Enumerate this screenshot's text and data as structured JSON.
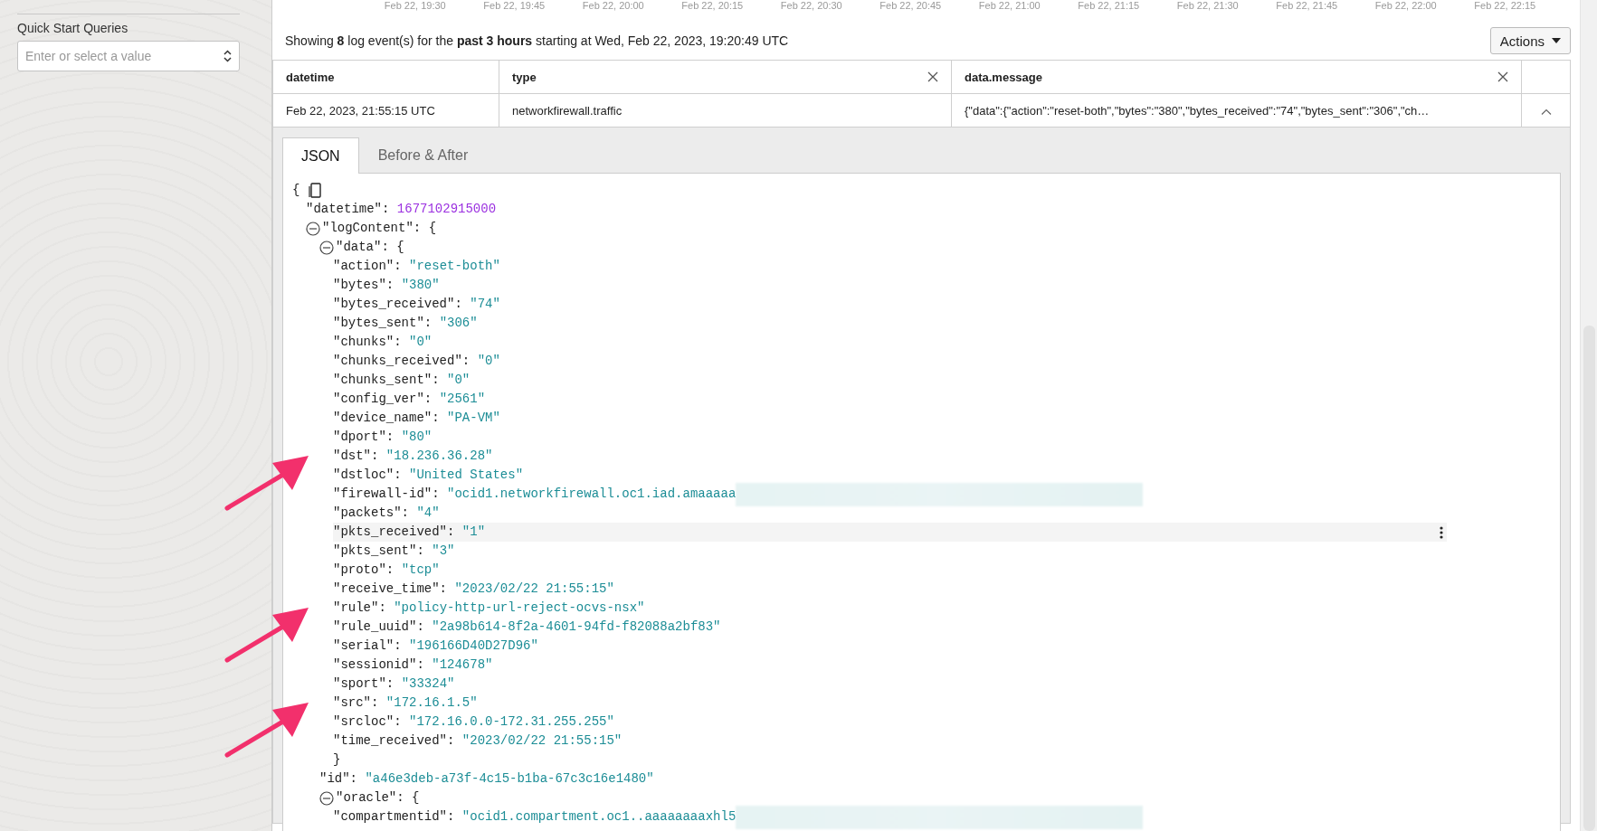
{
  "sidebar": {
    "label": "Quick Start Queries",
    "select": {
      "placeholder": "Enter or select a value"
    }
  },
  "timeline": {
    "ticks": [
      "Feb 22, 19:30",
      "Feb 22, 19:45",
      "Feb 22, 20:00",
      "Feb 22, 20:15",
      "Feb 22, 20:30",
      "Feb 22, 20:45",
      "Feb 22, 21:00",
      "Feb 22, 21:15",
      "Feb 22, 21:30",
      "Feb 22, 21:45",
      "Feb 22, 22:00",
      "Feb 22, 22:15"
    ]
  },
  "summary": "Showing **8** log event(s) for the **past 3 hours** starting at Wed, Feb 22, 2023, 19:20:49 UTC",
  "actions_button": "Actions",
  "table": {
    "columns": [
      {
        "label": "datetime",
        "closable": false
      },
      {
        "label": "type",
        "closable": true
      },
      {
        "label": "data.message",
        "closable": true
      }
    ],
    "rows": [
      {
        "cells": [
          "Feb 22, 2023, 21:55:15 UTC",
          "networkfirewall.traffic",
          "{\"data\":{\"action\":\"reset-both\",\"bytes\":\"380\",\"bytes_received\":\"74\",\"bytes_sent\":\"306\",\"ch…"
        ],
        "expanded": true
      }
    ]
  },
  "tabs": [
    {
      "label": "JSON",
      "selected": true
    },
    {
      "label": "Before & After",
      "selected": false
    }
  ],
  "json": {
    "open": "{",
    "children": [
      {
        "kind": "number",
        "key": "\"datetime\":",
        "value": "1677102915000",
        "highlighted": false,
        "arrow": false,
        "redacted": false
      },
      {
        "kind": "object",
        "key": "\"logContent\":",
        "open": "{",
        "expanded": true,
        "highlighted": false,
        "arrow": false,
        "redacted": false,
        "children": [
          {
            "kind": "object",
            "key": "\"data\":",
            "open": "{",
            "close": "}",
            "expanded": true,
            "highlighted": false,
            "arrow": false,
            "redacted": false,
            "children": [
              {
                "kind": "string",
                "key": "\"action\":",
                "value": "\"reset-both\"",
                "highlighted": false,
                "arrow": false,
                "redacted": false
              },
              {
                "kind": "string",
                "key": "\"bytes\":",
                "value": "\"380\"",
                "highlighted": false,
                "arrow": false,
                "redacted": false
              },
              {
                "kind": "string",
                "key": "\"bytes_received\":",
                "value": "\"74\"",
                "highlighted": false,
                "arrow": false,
                "redacted": false
              },
              {
                "kind": "string",
                "key": "\"bytes_sent\":",
                "value": "\"306\"",
                "highlighted": false,
                "arrow": false,
                "redacted": false
              },
              {
                "kind": "string",
                "key": "\"chunks\":",
                "value": "\"0\"",
                "highlighted": false,
                "arrow": false,
                "redacted": false
              },
              {
                "kind": "string",
                "key": "\"chunks_received\":",
                "value": "\"0\"",
                "highlighted": false,
                "arrow": false,
                "redacted": false
              },
              {
                "kind": "string",
                "key": "\"chunks_sent\":",
                "value": "\"0\"",
                "highlighted": false,
                "arrow": false,
                "redacted": false
              },
              {
                "kind": "string",
                "key": "\"config_ver\":",
                "value": "\"2561\"",
                "highlighted": false,
                "arrow": false,
                "redacted": false
              },
              {
                "kind": "string",
                "key": "\"device_name\":",
                "value": "\"PA-VM\"",
                "highlighted": false,
                "arrow": false,
                "redacted": false
              },
              {
                "kind": "string",
                "key": "\"dport\":",
                "value": "\"80\"",
                "highlighted": false,
                "arrow": false,
                "redacted": false
              },
              {
                "kind": "string",
                "key": "\"dst\":",
                "value": "\"18.236.36.28\"",
                "highlighted": false,
                "arrow": true,
                "redacted": false
              },
              {
                "kind": "string",
                "key": "\"dstloc\":",
                "value": "\"United States\"",
                "highlighted": false,
                "arrow": false,
                "redacted": false
              },
              {
                "kind": "string",
                "key": "\"firewall-id\":",
                "value": "\"ocid1.networkfirewall.oc1.iad.amaaaaa",
                "highlighted": false,
                "arrow": false,
                "redacted": true
              },
              {
                "kind": "string",
                "key": "\"packets\":",
                "value": "\"4\"",
                "highlighted": false,
                "arrow": false,
                "redacted": false
              },
              {
                "kind": "string",
                "key": "\"pkts_received\":",
                "value": "\"1\"",
                "highlighted": true,
                "arrow": false,
                "redacted": false
              },
              {
                "kind": "string",
                "key": "\"pkts_sent\":",
                "value": "\"3\"",
                "highlighted": false,
                "arrow": false,
                "redacted": false
              },
              {
                "kind": "string",
                "key": "\"proto\":",
                "value": "\"tcp\"",
                "highlighted": false,
                "arrow": false,
                "redacted": false
              },
              {
                "kind": "string",
                "key": "\"receive_time\":",
                "value": "\"2023/02/22 21:55:15\"",
                "highlighted": false,
                "arrow": false,
                "redacted": false
              },
              {
                "kind": "string",
                "key": "\"rule\":",
                "value": "\"policy-http-url-reject-ocvs-nsx\"",
                "highlighted": false,
                "arrow": true,
                "redacted": false
              },
              {
                "kind": "string",
                "key": "\"rule_uuid\":",
                "value": "\"2a98b614-8f2a-4601-94fd-f82088a2bf83\"",
                "highlighted": false,
                "arrow": false,
                "redacted": false
              },
              {
                "kind": "string",
                "key": "\"serial\":",
                "value": "\"196166D40D27D96\"",
                "highlighted": false,
                "arrow": false,
                "redacted": false
              },
              {
                "kind": "string",
                "key": "\"sessionid\":",
                "value": "\"124678\"",
                "highlighted": false,
                "arrow": false,
                "redacted": false
              },
              {
                "kind": "string",
                "key": "\"sport\":",
                "value": "\"33324\"",
                "highlighted": false,
                "arrow": false,
                "redacted": false
              },
              {
                "kind": "string",
                "key": "\"src\":",
                "value": "\"172.16.1.5\"",
                "highlighted": false,
                "arrow": true,
                "redacted": false
              },
              {
                "kind": "string",
                "key": "\"srcloc\":",
                "value": "\"172.16.0.0-172.31.255.255\"",
                "highlighted": false,
                "arrow": false,
                "redacted": false
              },
              {
                "kind": "string",
                "key": "\"time_received\":",
                "value": "\"2023/02/22 21:55:15\"",
                "highlighted": false,
                "arrow": false,
                "redacted": false
              }
            ]
          },
          {
            "kind": "string",
            "key": "\"id\":",
            "value": "\"a46e3deb-a73f-4c15-b1ba-67c3c16e1480\"",
            "highlighted": false,
            "arrow": false,
            "redacted": false
          },
          {
            "kind": "object",
            "key": "\"oracle\":",
            "open": "{",
            "expanded": true,
            "highlighted": false,
            "arrow": false,
            "redacted": false,
            "children": [
              {
                "kind": "string",
                "key": "\"compartmentid\":",
                "value": "\"ocid1.compartment.oc1..aaaaaaaaxhl5",
                "highlighted": false,
                "arrow": false,
                "redacted": true
              }
            ]
          }
        ]
      }
    ]
  }
}
